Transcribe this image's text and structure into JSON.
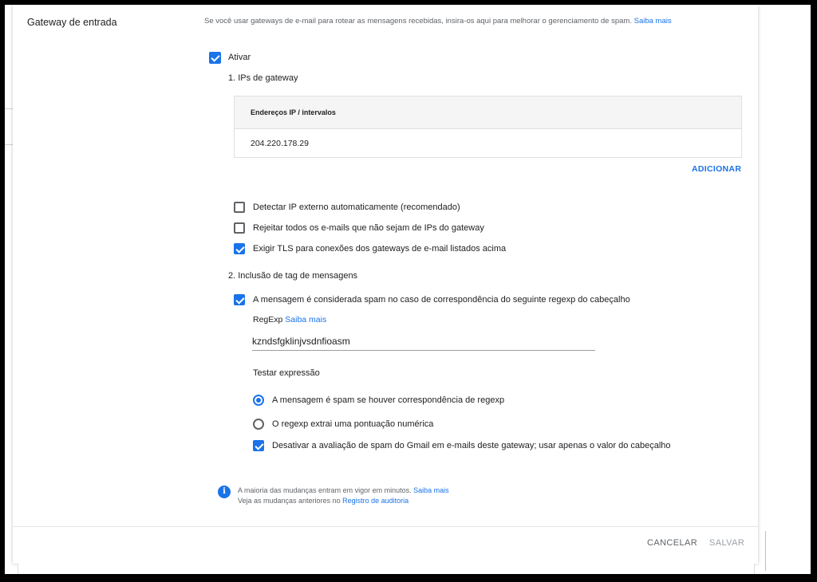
{
  "section": {
    "title": "Gateway de entrada",
    "description": "Se você usar gateways de e-mail para rotear as mensagens recebidas, insira-os aqui para melhorar o gerenciamento de spam.",
    "description_link": "Saiba mais"
  },
  "enable": {
    "label": "Ativar",
    "checked": true
  },
  "gateway_ips": {
    "heading": "1. IPs de gateway",
    "table_header": "Endereços IP / intervalos",
    "rows": [
      "204.220.178.29"
    ],
    "add_button": "ADICIONAR"
  },
  "options": [
    {
      "label": "Detectar IP externo automaticamente (recomendado)",
      "checked": false
    },
    {
      "label": "Rejeitar todos os e-mails que não sejam de IPs do gateway",
      "checked": false
    },
    {
      "label": "Exigir TLS para conexões dos gateways de e-mail listados acima",
      "checked": true
    }
  ],
  "tagging": {
    "heading": "2. Inclusão de tag de mensagens",
    "spam_header_option": {
      "label": "A mensagem é considerada spam no caso de correspondência do seguinte regexp do cabeçalho",
      "checked": true
    },
    "regexp_label": "RegExp",
    "regexp_link": "Saiba mais",
    "regexp_value": "kzndsfgklinjvsdnfioasm",
    "test_link": "Testar expressão",
    "radios": [
      {
        "label": "A mensagem é spam se houver correspondência de regexp",
        "checked": true
      },
      {
        "label": "O regexp extrai uma pontuação numérica",
        "checked": false
      }
    ],
    "disable_gmail": {
      "label": "Desativar a avaliação de spam do Gmail em e-mails deste gateway; usar apenas o valor do cabeçalho",
      "checked": true
    }
  },
  "info": {
    "line1": "A maioria das mudanças entram em vigor em minutos.",
    "line1_link": "Saiba mais",
    "line2": "Veja as mudanças anteriores no",
    "line2_link": "Registro de auditoria"
  },
  "footer": {
    "cancel": "CANCELAR",
    "save": "SALVAR"
  },
  "colors": {
    "accent": "#1a73e8",
    "disabled": "#9aa0a6"
  }
}
